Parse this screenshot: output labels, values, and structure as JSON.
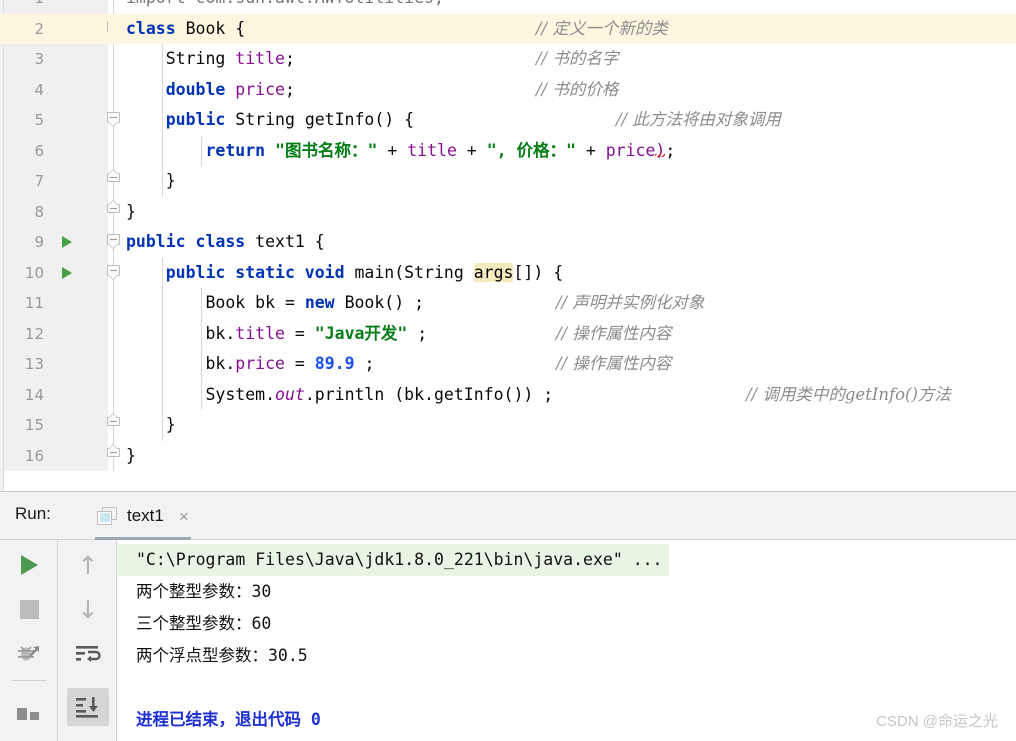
{
  "editor": {
    "lines": [
      {
        "no": "1",
        "run": false,
        "fold": "none",
        "partial": true,
        "tokens": [
          {
            "t": "import com.sun.awt.AWTUtilities;",
            "c": "plain"
          }
        ],
        "comment": "",
        "highlight": false,
        "indent": 0
      },
      {
        "no": "2",
        "run": false,
        "fold": "start",
        "tokens": [
          {
            "t": "class ",
            "c": "kw"
          },
          {
            "t": "Book {",
            "c": "plain"
          }
        ],
        "comment": "// 定义一个新的类",
        "highlight": true,
        "indent": 0
      },
      {
        "no": "3",
        "run": false,
        "fold": "none",
        "tokens": [
          {
            "t": "    String ",
            "c": "plain"
          },
          {
            "t": "title",
            "c": "fld"
          },
          {
            "t": ";",
            "c": "plain"
          }
        ],
        "comment": "// 书的名字",
        "highlight": false,
        "indent": 1
      },
      {
        "no": "4",
        "run": false,
        "fold": "none",
        "tokens": [
          {
            "t": "    double ",
            "c": "kw"
          },
          {
            "t": "price",
            "c": "fld"
          },
          {
            "t": ";",
            "c": "plain"
          }
        ],
        "comment": "// 书的价格",
        "highlight": false,
        "indent": 1
      },
      {
        "no": "5",
        "run": false,
        "fold": "start",
        "tokens": [
          {
            "t": "    public ",
            "c": "kw"
          },
          {
            "t": "String getInfo() {",
            "c": "plain"
          }
        ],
        "comment": "// 此方法将由对象调用",
        "highlight": false,
        "indent": 1
      },
      {
        "no": "6",
        "run": false,
        "fold": "none",
        "tokens": [
          {
            "t": "        return ",
            "c": "kw"
          },
          {
            "t": "\"图书名称：\"",
            "c": "str"
          },
          {
            "t": " + ",
            "c": "plain"
          },
          {
            "t": "title",
            "c": "fld"
          },
          {
            "t": " + ",
            "c": "plain"
          },
          {
            "t": "\", 价格：\"",
            "c": "str"
          },
          {
            "t": " + ",
            "c": "plain"
          },
          {
            "t": "price",
            "c": "fld"
          },
          {
            "t": ")",
            "c": "err"
          },
          {
            "t": ";",
            "c": "plain"
          }
        ],
        "comment": "",
        "highlight": false,
        "indent": 2
      },
      {
        "no": "7",
        "run": false,
        "fold": "end",
        "tokens": [
          {
            "t": "    }",
            "c": "plain"
          }
        ],
        "comment": "",
        "highlight": false,
        "indent": 1
      },
      {
        "no": "8",
        "run": false,
        "fold": "end",
        "tokens": [
          {
            "t": "}",
            "c": "plain"
          }
        ],
        "comment": "",
        "highlight": false,
        "indent": 0
      },
      {
        "no": "9",
        "run": true,
        "fold": "start",
        "tokens": [
          {
            "t": "public class ",
            "c": "kw"
          },
          {
            "t": "text1 {",
            "c": "plain"
          }
        ],
        "comment": "",
        "highlight": false,
        "indent": 0
      },
      {
        "no": "10",
        "run": true,
        "fold": "start",
        "tokens": [
          {
            "t": "    public static void ",
            "c": "kw"
          },
          {
            "t": "main(String ",
            "c": "plain"
          },
          {
            "t": "args",
            "c": "hlid"
          },
          {
            "t": "[]) {",
            "c": "plain"
          }
        ],
        "comment": "",
        "highlight": false,
        "indent": 1
      },
      {
        "no": "11",
        "run": false,
        "fold": "none",
        "tokens": [
          {
            "t": "        Book bk = ",
            "c": "plain"
          },
          {
            "t": "new ",
            "c": "kw"
          },
          {
            "t": "Book() ;",
            "c": "plain"
          }
        ],
        "comment": "// 声明并实例化对象",
        "highlight": false,
        "indent": 2
      },
      {
        "no": "12",
        "run": false,
        "fold": "none",
        "tokens": [
          {
            "t": "        bk.",
            "c": "plain"
          },
          {
            "t": "title",
            "c": "fld"
          },
          {
            "t": " = ",
            "c": "plain"
          },
          {
            "t": "\"Java开发\"",
            "c": "str"
          },
          {
            "t": " ;",
            "c": "plain"
          }
        ],
        "comment": "// 操作属性内容",
        "highlight": false,
        "indent": 2
      },
      {
        "no": "13",
        "run": false,
        "fold": "none",
        "tokens": [
          {
            "t": "        bk.",
            "c": "plain"
          },
          {
            "t": "price",
            "c": "fld"
          },
          {
            "t": " = ",
            "c": "plain"
          },
          {
            "t": "89.9",
            "c": "num"
          },
          {
            "t": " ;",
            "c": "plain"
          }
        ],
        "comment": "// 操作属性内容",
        "highlight": false,
        "indent": 2
      },
      {
        "no": "14",
        "run": false,
        "fold": "none",
        "tokens": [
          {
            "t": "        System.",
            "c": "plain"
          },
          {
            "t": "out",
            "c": "stat"
          },
          {
            "t": ".println (bk.getInfo()) ;",
            "c": "plain"
          }
        ],
        "comment": "// 调用类中的getInfo()方法",
        "highlight": false,
        "indent": 2
      },
      {
        "no": "15",
        "run": false,
        "fold": "end",
        "tokens": [
          {
            "t": "    }",
            "c": "plain"
          }
        ],
        "comment": "",
        "highlight": false,
        "indent": 1
      },
      {
        "no": "16",
        "run": false,
        "fold": "end",
        "tokens": [
          {
            "t": "}",
            "c": "plain"
          }
        ],
        "comment": "",
        "highlight": false,
        "indent": 0
      }
    ],
    "comment_offsets": [
      0,
      410,
      410,
      410,
      490,
      0,
      0,
      0,
      0,
      0,
      430,
      430,
      430,
      620,
      0,
      0
    ]
  },
  "run_panel": {
    "label": "Run:",
    "tab_title": "text1",
    "tab_close": "×",
    "toolbar_left": [
      {
        "name": "rerun-button",
        "icon": "play-icon"
      },
      {
        "name": "stop-button",
        "icon": "stop-icon"
      },
      {
        "name": "debug-button",
        "icon": "bug-icon"
      },
      {
        "name": "pin-button",
        "icon": "pin-icon"
      }
    ],
    "toolbar_right": [
      {
        "name": "up-button",
        "icon": "arrow-up-icon",
        "glyph": "↑"
      },
      {
        "name": "down-button",
        "icon": "arrow-down-icon",
        "glyph": "↓"
      },
      {
        "name": "soft-wrap-button",
        "icon": "soft-wrap-icon"
      },
      {
        "name": "scroll-to-end-button",
        "icon": "scroll-to-end-icon"
      }
    ],
    "console": {
      "command_line": "\"C:\\Program Files\\Java\\jdk1.8.0_221\\bin\\java.exe\" ...",
      "output_lines": [
        "两个整型参数：30",
        "三个整型参数：60",
        "两个浮点型参数：30.5",
        "",
        "进程已结束，退出代码 0"
      ],
      "exit_line_index": 4
    }
  },
  "watermark": "CSDN @命运之光",
  "colors": {
    "keyword": "#0033b3",
    "string": "#067d17",
    "number": "#1750eb",
    "field": "#871094",
    "comment": "#8c8c8c",
    "highlight_line": "#fdf7e0",
    "identifier_highlight": "#f6ebbe",
    "console_cmd_bg": "#e8f5e4",
    "exit_code": "#1f2fd1",
    "run_green": "#4e9a51"
  }
}
